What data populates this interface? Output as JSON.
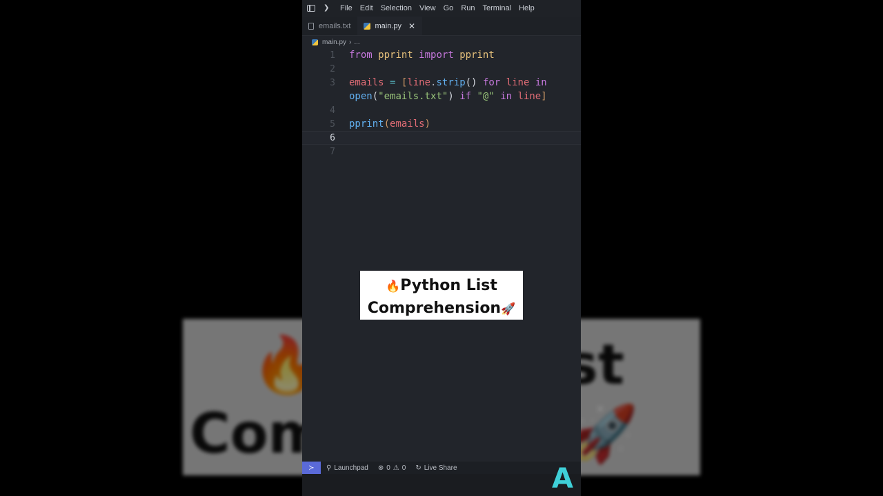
{
  "menu": [
    "File",
    "Edit",
    "Selection",
    "View",
    "Go",
    "Run",
    "Terminal",
    "Help"
  ],
  "tabs": [
    {
      "label": "emails.txt",
      "active": false
    },
    {
      "label": "main.py",
      "active": true
    }
  ],
  "breadcrumb": {
    "file": "main.py",
    "more": "..."
  },
  "line_numbers": [
    "1",
    "2",
    "3",
    "",
    "4",
    "5",
    "6",
    "7"
  ],
  "code": {
    "l1": {
      "a": "from",
      "b": "pprint",
      "c": "import",
      "d": "pprint"
    },
    "l3a": {
      "a": "emails",
      "b": "=",
      "c": "[",
      "d": "line",
      "e": ".",
      "f": "strip",
      "g": "()",
      "h": "for",
      "i": "line",
      "j": "in"
    },
    "l3b": {
      "a": "open",
      "b": "(",
      "c": "\"emails.txt\"",
      "d": ")",
      "e": "if",
      "f": "\"@\"",
      "g": "in",
      "h": "line",
      "i": "]"
    },
    "l5": {
      "a": "pprint",
      "b": "(",
      "c": "emails",
      "d": ")"
    }
  },
  "caption": {
    "line1": "Python List",
    "line2": "Comprehension",
    "emoji1": "🔥",
    "emoji2": "🚀"
  },
  "bg_caption": {
    "line1": "🔥",
    "line2": "Com",
    "rt": "st",
    "rb": "on🚀"
  },
  "statusbar": {
    "launchpad": "Launchpad",
    "errors": "0",
    "warnings": "0",
    "live_share": "Live Share"
  },
  "channel_logo": "A",
  "colors": {
    "accent": "#5a6ad8",
    "keyword": "#c678dd",
    "function": "#61afef",
    "variable": "#e06c75",
    "string": "#98c379"
  }
}
